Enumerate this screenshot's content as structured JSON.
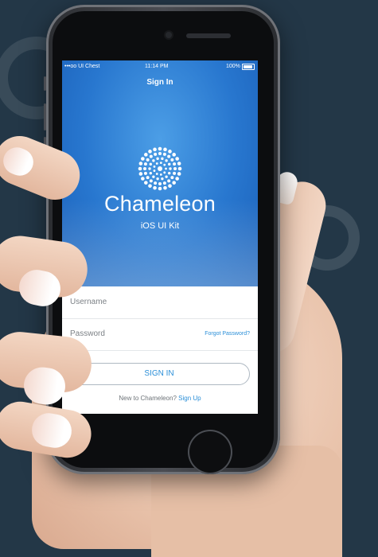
{
  "colors": {
    "background": "#233747",
    "accent": "#2b8fd8",
    "hero_top": "#4c9ee6",
    "hero_bottom": "#1a5fb8"
  },
  "status_bar": {
    "carrier": "•••oo UI Chest",
    "time": "11:14 PM",
    "battery": "100%"
  },
  "nav": {
    "title": "Sign In"
  },
  "hero": {
    "logo_icon": "dotted-circle-logo-icon",
    "brand": "Chameleon",
    "subtitle": "iOS UI Kit"
  },
  "form": {
    "username_placeholder": "Username",
    "password_placeholder": "Password",
    "forgot_label": "Forgot Password?",
    "signin_label": "SIGN IN",
    "signup_prompt": "New to Chameleon?",
    "signup_link": "Sign Up"
  }
}
